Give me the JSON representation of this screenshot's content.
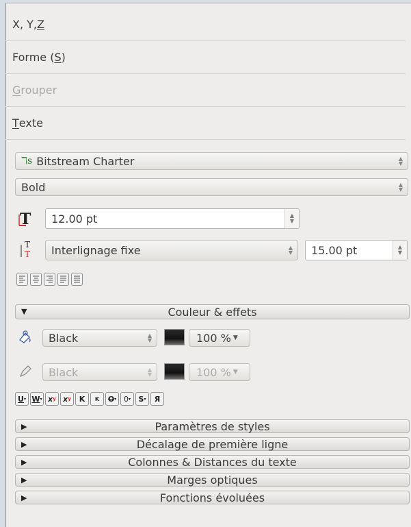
{
  "sections": [
    {
      "pre": "X, Y, ",
      "mn": "Z",
      "post": ""
    },
    {
      "pre": "Forme (",
      "mn": "S",
      "post": ")"
    },
    {
      "pre": "",
      "mn": "G",
      "post": "rouper"
    },
    {
      "pre": "",
      "mn": "T",
      "post": "exte"
    }
  ],
  "text": {
    "font_family": "Bitstream Charter",
    "font_style": "Bold",
    "font_size": "12.00 pt",
    "line_spacing_mode": "Interlignage fixe",
    "line_spacing_value": "15.00 pt",
    "alignments": [
      "align-left",
      "align-center",
      "align-right",
      "align-justify",
      "align-forced"
    ]
  },
  "couleur": {
    "header": "Couleur & effets",
    "fill_color": "Black",
    "fill_shade": "100 %",
    "stroke_color": "Black",
    "stroke_shade": "100 %",
    "effects": [
      "U",
      "W",
      "x",
      "x",
      "K",
      "K",
      "O",
      "0",
      "S",
      "Я"
    ]
  },
  "collapsed_panels": [
    "Paramètres de styles",
    "Décalage de première ligne",
    "Colonnes & Distances du texte",
    "Marges optiques",
    "Fonctions évoluées"
  ]
}
